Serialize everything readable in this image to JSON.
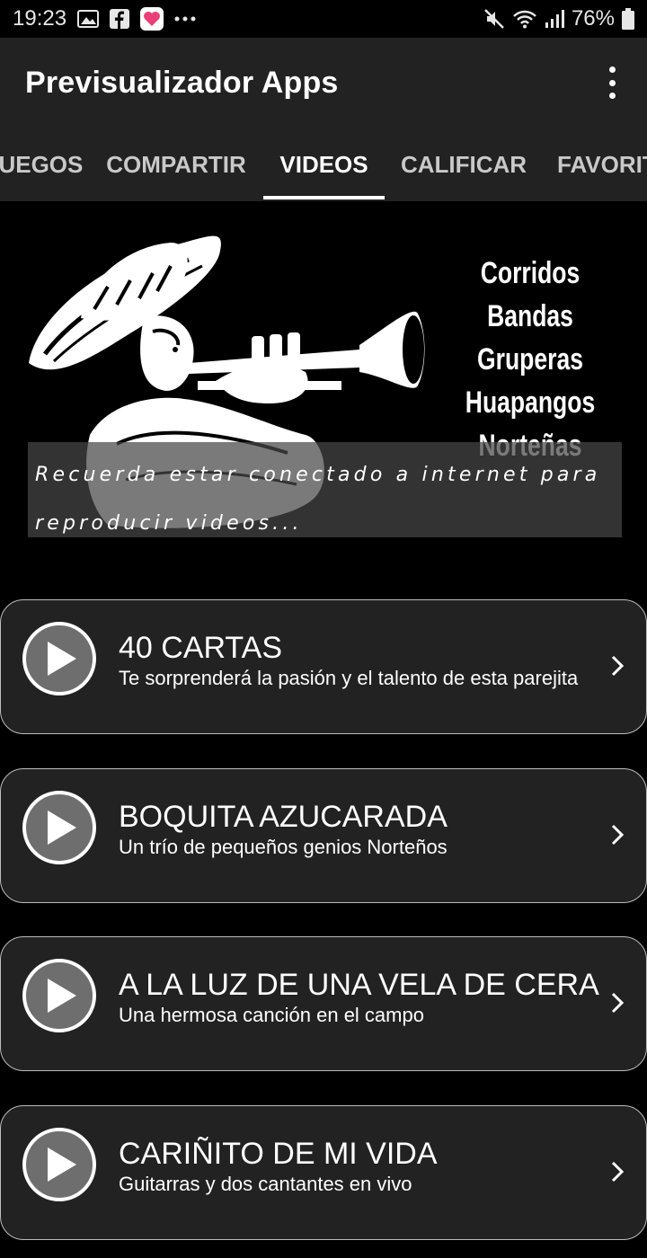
{
  "status_bar": {
    "time": "19:23",
    "battery": "76%",
    "icons": [
      "gallery-icon",
      "facebook-icon",
      "app-notification-icon",
      "more-notifications-icon",
      "mute-icon",
      "wifi-icon",
      "signal-icon",
      "battery-icon"
    ]
  },
  "app_bar": {
    "title": "Previsualizador Apps",
    "overflow_icon": "more-vert-icon"
  },
  "tabs": [
    {
      "label": "JUEGOS",
      "active": false
    },
    {
      "label": "COMPARTIR",
      "active": false
    },
    {
      "label": "VIDEOS",
      "active": true
    },
    {
      "label": "CALIFICAR",
      "active": false
    },
    {
      "label": "FAVORITOS",
      "active": false
    }
  ],
  "banner": {
    "words": [
      "Corridos",
      "Bandas",
      "Gruperas",
      "Huapangos",
      "Norteñas"
    ],
    "caption": "Recuerda estar conectado a internet para reproducir videos..."
  },
  "videos": [
    {
      "title": "40 CARTAS",
      "subtitle": "Te sorprenderá la pasión y el talento de esta parejita"
    },
    {
      "title": "BOQUITA AZUCARADA",
      "subtitle": "Un trío de pequeños genios Norteños"
    },
    {
      "title": "A LA LUZ DE UNA VELA DE CERA",
      "subtitle": "Una hermosa canción en el campo"
    },
    {
      "title": "CARIÑITO DE MI VIDA",
      "subtitle": "Guitarras y dos cantantes en vivo"
    }
  ],
  "colors": {
    "background": "#000000",
    "surface": "#222222",
    "accent": "#ffffff",
    "inactive_tab": "#c9c9c9"
  }
}
